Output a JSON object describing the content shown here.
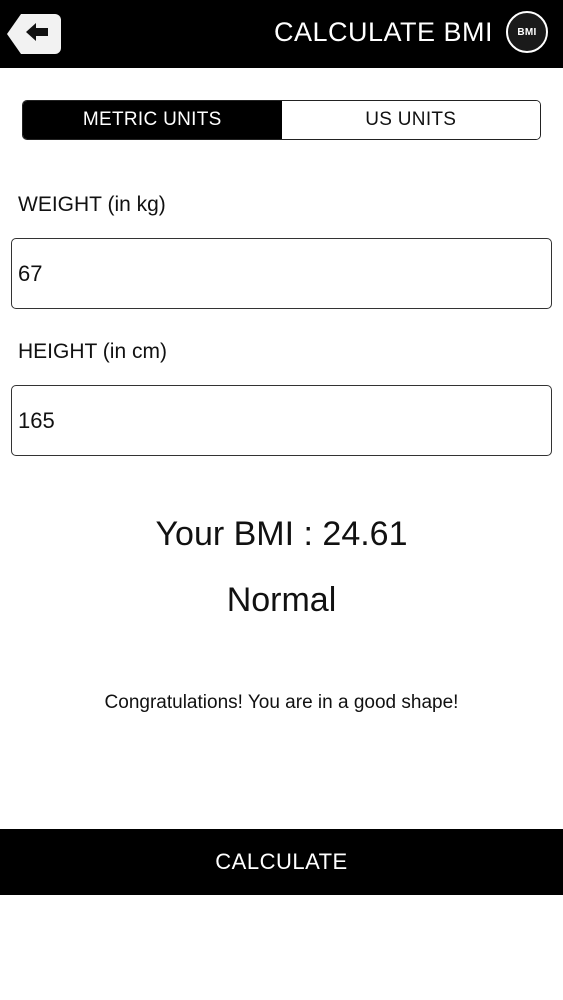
{
  "header": {
    "title": "CALCULATE BMI",
    "badge_label": "BMI",
    "back_icon": "back-arrow-icon"
  },
  "units": {
    "tabs": [
      "METRIC UNITS",
      "US UNITS"
    ],
    "selected": "METRIC UNITS"
  },
  "weight": {
    "label": "WEIGHT (in kg)",
    "value": "67"
  },
  "height": {
    "label": "HEIGHT (in cm)",
    "value": "165"
  },
  "result": {
    "bmi_text": "Your BMI : 24.61",
    "category": "Normal",
    "message": "Congratulations! You are in a good shape!"
  },
  "actions": {
    "calculate_label": "CALCULATE"
  },
  "colors": {
    "bar": "#000000",
    "text": "#111111",
    "background": "#ffffff"
  }
}
